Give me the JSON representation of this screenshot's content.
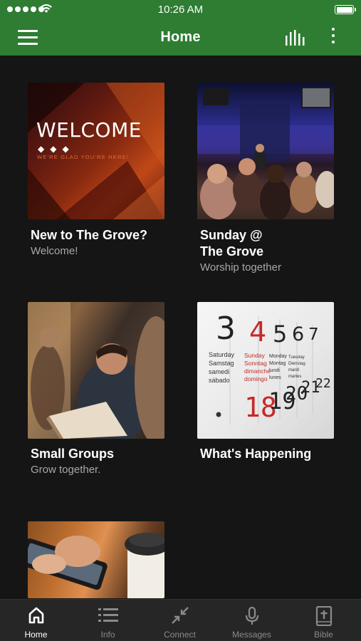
{
  "status_bar": {
    "time": "10:26 AM"
  },
  "header": {
    "title": "Home"
  },
  "tiles": [
    {
      "title": "New to The Grove?",
      "subtitle": "Welcome!"
    },
    {
      "title": "Sunday @\nThe Grove",
      "subtitle": "Worship together"
    },
    {
      "title": "Small Groups",
      "subtitle": "Grow together."
    },
    {
      "title": "What's Happening",
      "subtitle": ""
    }
  ],
  "welcome_image": {
    "headline": "WELCOME",
    "tagline": "WE'RE GLAD YOU'RE HERE!"
  },
  "calendar_image": {
    "numbers": [
      "3",
      "4",
      "5",
      "6",
      "7"
    ],
    "bottom_numbers": [
      "18",
      "19",
      "20",
      "21",
      "22"
    ],
    "day_labels": [
      "Saturday\nSamstag\nsamedi\nsábado",
      "Sunday\nSonntag\ndimanche\ndomingo",
      "Monday\nMontag\nlundi\nlunes",
      "Tuesday\nDienstag\nmardi\nmartes"
    ]
  },
  "tab_bar": [
    {
      "label": "Home",
      "icon": "home-icon",
      "active": true
    },
    {
      "label": "Info",
      "icon": "list-icon",
      "active": false
    },
    {
      "label": "Connect",
      "icon": "connect-icon",
      "active": false
    },
    {
      "label": "Messages",
      "icon": "microphone-icon",
      "active": false
    },
    {
      "label": "Bible",
      "icon": "bible-icon",
      "active": false
    }
  ],
  "colors": {
    "brand_green": "#2e7d32",
    "background": "#151515",
    "tab_bar": "#262626"
  }
}
